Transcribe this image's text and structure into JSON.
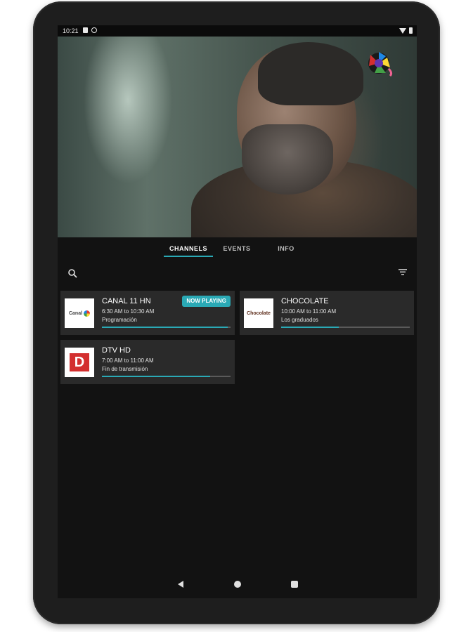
{
  "status": {
    "time": "10:21"
  },
  "tabs": [
    {
      "label": "CHANNELS"
    },
    {
      "label": "EVENTS"
    },
    {
      "label": "INFO"
    }
  ],
  "channels": [
    {
      "name": "CANAL 11 HN",
      "time": "6:30 AM to 10:30 AM",
      "program": "Programación",
      "progress": 0.98,
      "badge": "NOW PLAYING",
      "logo_text": "Canal"
    },
    {
      "name": "CHOCOLATE",
      "time": "10:00 AM to 11:00 AM",
      "program": "Los graduados",
      "progress": 0.45,
      "logo_text": "Chocolate"
    },
    {
      "name": "DTV HD",
      "time": "7:00 AM to 11:00 AM",
      "program": "Fin de transmisión",
      "progress": 0.84,
      "logo_text": "D"
    }
  ],
  "colors": {
    "accent": "#2aa9b5",
    "background": "#121212",
    "card": "#2a2a2a"
  },
  "icons": {
    "search": "search-icon",
    "filter": "filter-icon"
  }
}
